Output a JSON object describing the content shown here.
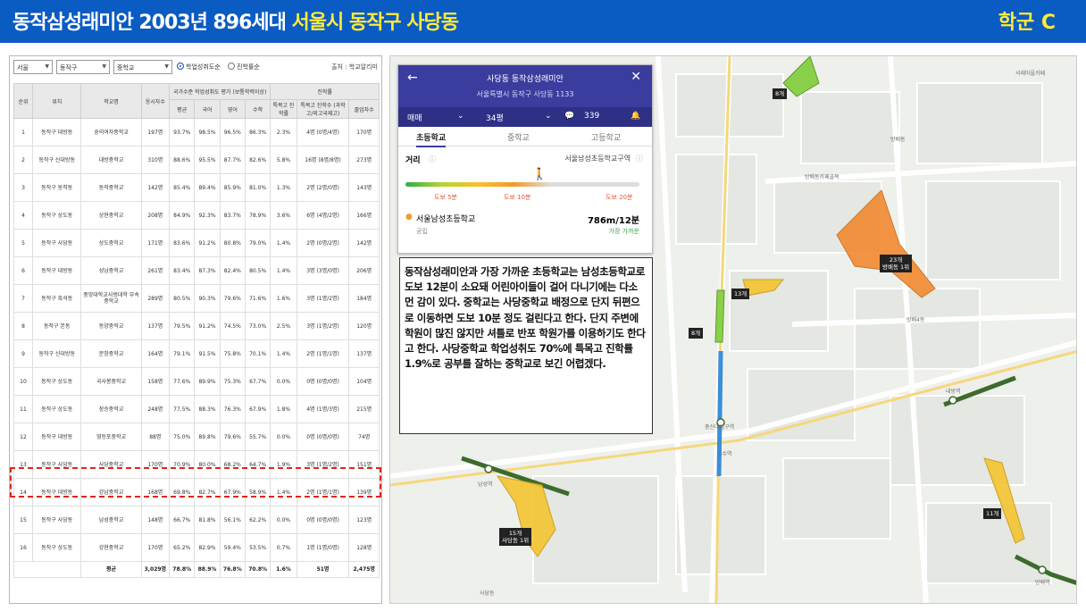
{
  "header": {
    "title_part1": "동작삼성래미안 2003년 896세대",
    "title_part2": "서울시 동작구 사당동",
    "badge": "학군 C"
  },
  "filters": {
    "city": "서울",
    "district": "동작구",
    "level": "중학교",
    "radio1": "학업성취도순",
    "radio2": "진학률순",
    "source": "출처 : 학교알리미"
  },
  "table": {
    "headers": {
      "rank": "순위",
      "location": "위치",
      "school": "학교명",
      "takers": "응시자수",
      "group_achieve": "국가수준 학업성취도 평가 (보통학력이상)",
      "group_advance": "진학률",
      "avg": "평균",
      "kor": "국어",
      "eng": "영어",
      "math": "수학",
      "special_rate": "특목고 진학률",
      "special_count": "특목고 진학수 (과학고/외고국제고)",
      "grads": "졸업자수"
    },
    "rows": [
      {
        "rank": "1",
        "loc": "동작구 대방동",
        "school": "숭의여자중학교",
        "takers": "197명",
        "avg": "93.7%",
        "kor": "98.5%",
        "eng": "96.5%",
        "math": "86.3%",
        "rate": "2.3%",
        "count": "4명 (0명/4명)",
        "grads": "170명"
      },
      {
        "rank": "2",
        "loc": "동작구 신대방동",
        "school": "대방중학교",
        "takers": "310명",
        "avg": "88.6%",
        "kor": "95.5%",
        "eng": "87.7%",
        "math": "82.6%",
        "rate": "5.8%",
        "count": "16명 (8명/8명)",
        "grads": "273명"
      },
      {
        "rank": "3",
        "loc": "동작구 동작동",
        "school": "동작중학교",
        "takers": "142명",
        "avg": "85.4%",
        "kor": "89.4%",
        "eng": "85.9%",
        "math": "81.0%",
        "rate": "1.3%",
        "count": "2명 (2명/0명)",
        "grads": "143명"
      },
      {
        "rank": "4",
        "loc": "동작구 상도동",
        "school": "상현중학교",
        "takers": "208명",
        "avg": "84.9%",
        "kor": "92.3%",
        "eng": "83.7%",
        "math": "78.9%",
        "rate": "3.6%",
        "count": "6명 (4명/2명)",
        "grads": "166명"
      },
      {
        "rank": "5",
        "loc": "동작구 사당동",
        "school": "상도중학교",
        "takers": "171명",
        "avg": "83.6%",
        "kor": "91.2%",
        "eng": "80.8%",
        "math": "79.0%",
        "rate": "1.4%",
        "count": "2명 (0명/2명)",
        "grads": "142명"
      },
      {
        "rank": "6",
        "loc": "동작구 대방동",
        "school": "성남중학교",
        "takers": "261명",
        "avg": "83.4%",
        "kor": "87.3%",
        "eng": "82.4%",
        "math": "80.5%",
        "rate": "1.4%",
        "count": "3명 (3명/0명)",
        "grads": "206명"
      },
      {
        "rank": "7",
        "loc": "동작구 흑석동",
        "school": "중앙대학교사범대학 부속중학교",
        "takers": "289명",
        "avg": "80.5%",
        "kor": "90.3%",
        "eng": "79.6%",
        "math": "71.6%",
        "rate": "1.6%",
        "count": "3명 (1명/2명)",
        "grads": "184명"
      },
      {
        "rank": "8",
        "loc": "동작구 본동",
        "school": "동양중학교",
        "takers": "137명",
        "avg": "79.5%",
        "kor": "91.2%",
        "eng": "74.5%",
        "math": "73.0%",
        "rate": "2.5%",
        "count": "3명 (1명/2명)",
        "grads": "120명"
      },
      {
        "rank": "9",
        "loc": "동작구 신대방동",
        "school": "문창중학교",
        "takers": "164명",
        "avg": "79.1%",
        "kor": "91.5%",
        "eng": "75.8%",
        "math": "70.1%",
        "rate": "1.4%",
        "count": "2명 (1명/1명)",
        "grads": "137명"
      },
      {
        "rank": "10",
        "loc": "동작구 상도동",
        "school": "국사봉중학교",
        "takers": "158명",
        "avg": "77.6%",
        "kor": "89.9%",
        "eng": "75.3%",
        "math": "67.7%",
        "rate": "0.0%",
        "count": "0명 (0명/0명)",
        "grads": "104명"
      },
      {
        "rank": "11",
        "loc": "동작구 상도동",
        "school": "장승중학교",
        "takers": "248명",
        "avg": "77.5%",
        "kor": "88.3%",
        "eng": "76.3%",
        "math": "67.9%",
        "rate": "1.8%",
        "count": "4명 (1명/3명)",
        "grads": "215명"
      },
      {
        "rank": "12",
        "loc": "동작구 대방동",
        "school": "영등포중학교",
        "takers": "88명",
        "avg": "75.0%",
        "kor": "89.8%",
        "eng": "79.6%",
        "math": "55.7%",
        "rate": "0.0%",
        "count": "0명 (0명/0명)",
        "grads": "74명"
      },
      {
        "rank": "13",
        "loc": "동작구 사당동",
        "school": "사당중학교",
        "takers": "170명",
        "avg": "70.9%",
        "kor": "80.0%",
        "eng": "68.2%",
        "math": "64.7%",
        "rate": "1.9%",
        "count": "3명 (1명/2명)",
        "grads": "151명"
      },
      {
        "rank": "14",
        "loc": "동작구 대방동",
        "school": "강남중학교",
        "takers": "168명",
        "avg": "69.8%",
        "kor": "82.7%",
        "eng": "67.9%",
        "math": "58.9%",
        "rate": "1.4%",
        "count": "2명 (1명/1명)",
        "grads": "139명"
      },
      {
        "rank": "15",
        "loc": "동작구 사당동",
        "school": "남성중학교",
        "takers": "148명",
        "avg": "66.7%",
        "kor": "81.8%",
        "eng": "56.1%",
        "math": "62.2%",
        "rate": "0.0%",
        "count": "0명 (0명/0명)",
        "grads": "123명"
      },
      {
        "rank": "16",
        "loc": "동작구 상도동",
        "school": "강현중학교",
        "takers": "170명",
        "avg": "65.2%",
        "kor": "82.9%",
        "eng": "59.4%",
        "math": "53.5%",
        "rate": "0.7%",
        "count": "1명 (1명/0명)",
        "grads": "128명"
      }
    ],
    "total": {
      "label": "평균",
      "takers": "3,029명",
      "avg": "78.8%",
      "kor": "88.9%",
      "eng": "76.8%",
      "math": "70.8%",
      "rate": "1.6%",
      "count": "51명",
      "grads": "2,475명"
    }
  },
  "popup": {
    "title": "사당동 동작삼성래미안",
    "address": "서울특별시 동작구 사당동 1133",
    "trade": "매매",
    "size": "34평",
    "comments": "339",
    "tabs": [
      "초등학교",
      "중학교",
      "고등학교"
    ],
    "distance_label": "거리",
    "zone_label": "서울남성초등학교구역",
    "walk_5": "도보 5분",
    "walk_10": "도보 10분",
    "walk_20": "도보 20분",
    "school_name": "서울남성초등학교",
    "school_type": "공립",
    "school_distance": "786m/12분",
    "nearest": "가장 가까운"
  },
  "note": {
    "text": "동작삼성래미안과 가장 가까운 초등학교는 남성초등학교로 도보 12분이 소요돼 어린아이들이 걸어 다니기에는 다소 먼 감이 있다. 중학교는 사당중학교 배정으로 단지 뒤편으로 이동하면 도보 10분 정도 걸린다고 한다. 단지 주변에 학원이 많진 않지만 셔틀로 반포 학원가를 이용하기도 한다고 한다. 사당중학교 학업성취도 70%에 특목고 진학률 1.9%로 공부를 잘하는 중학교로 보긴 어렵겠다."
  },
  "map": {
    "tags": [
      {
        "id": "t1",
        "text": "8개"
      },
      {
        "id": "t2",
        "text": "23개",
        "sub": "방배동 1위"
      },
      {
        "id": "t3",
        "text": "13개"
      },
      {
        "id": "t4",
        "text": "8개"
      },
      {
        "id": "t5",
        "text": "15개",
        "sub": "사당동 1위"
      },
      {
        "id": "t6",
        "text": "11개"
      }
    ],
    "labels": [
      {
        "id": "m1",
        "text": "서래마을카페"
      },
      {
        "id": "m2",
        "text": "방배동"
      },
      {
        "id": "m3",
        "text": "방배동카페골목"
      },
      {
        "id": "m4",
        "text": "총신대입구역"
      },
      {
        "id": "m5",
        "text": "남성역"
      },
      {
        "id": "m6",
        "text": "사당동"
      },
      {
        "id": "m7",
        "text": "방배역"
      },
      {
        "id": "m8",
        "text": "내방역"
      },
      {
        "id": "m9",
        "text": "이수역"
      },
      {
        "id": "m10",
        "text": "방배4동"
      }
    ]
  },
  "colors": {
    "header": "#0a5bc2",
    "accent_yellow": "#ffeb3b",
    "highlight": "#e0261b",
    "popup_head": "#3b3d9e"
  }
}
